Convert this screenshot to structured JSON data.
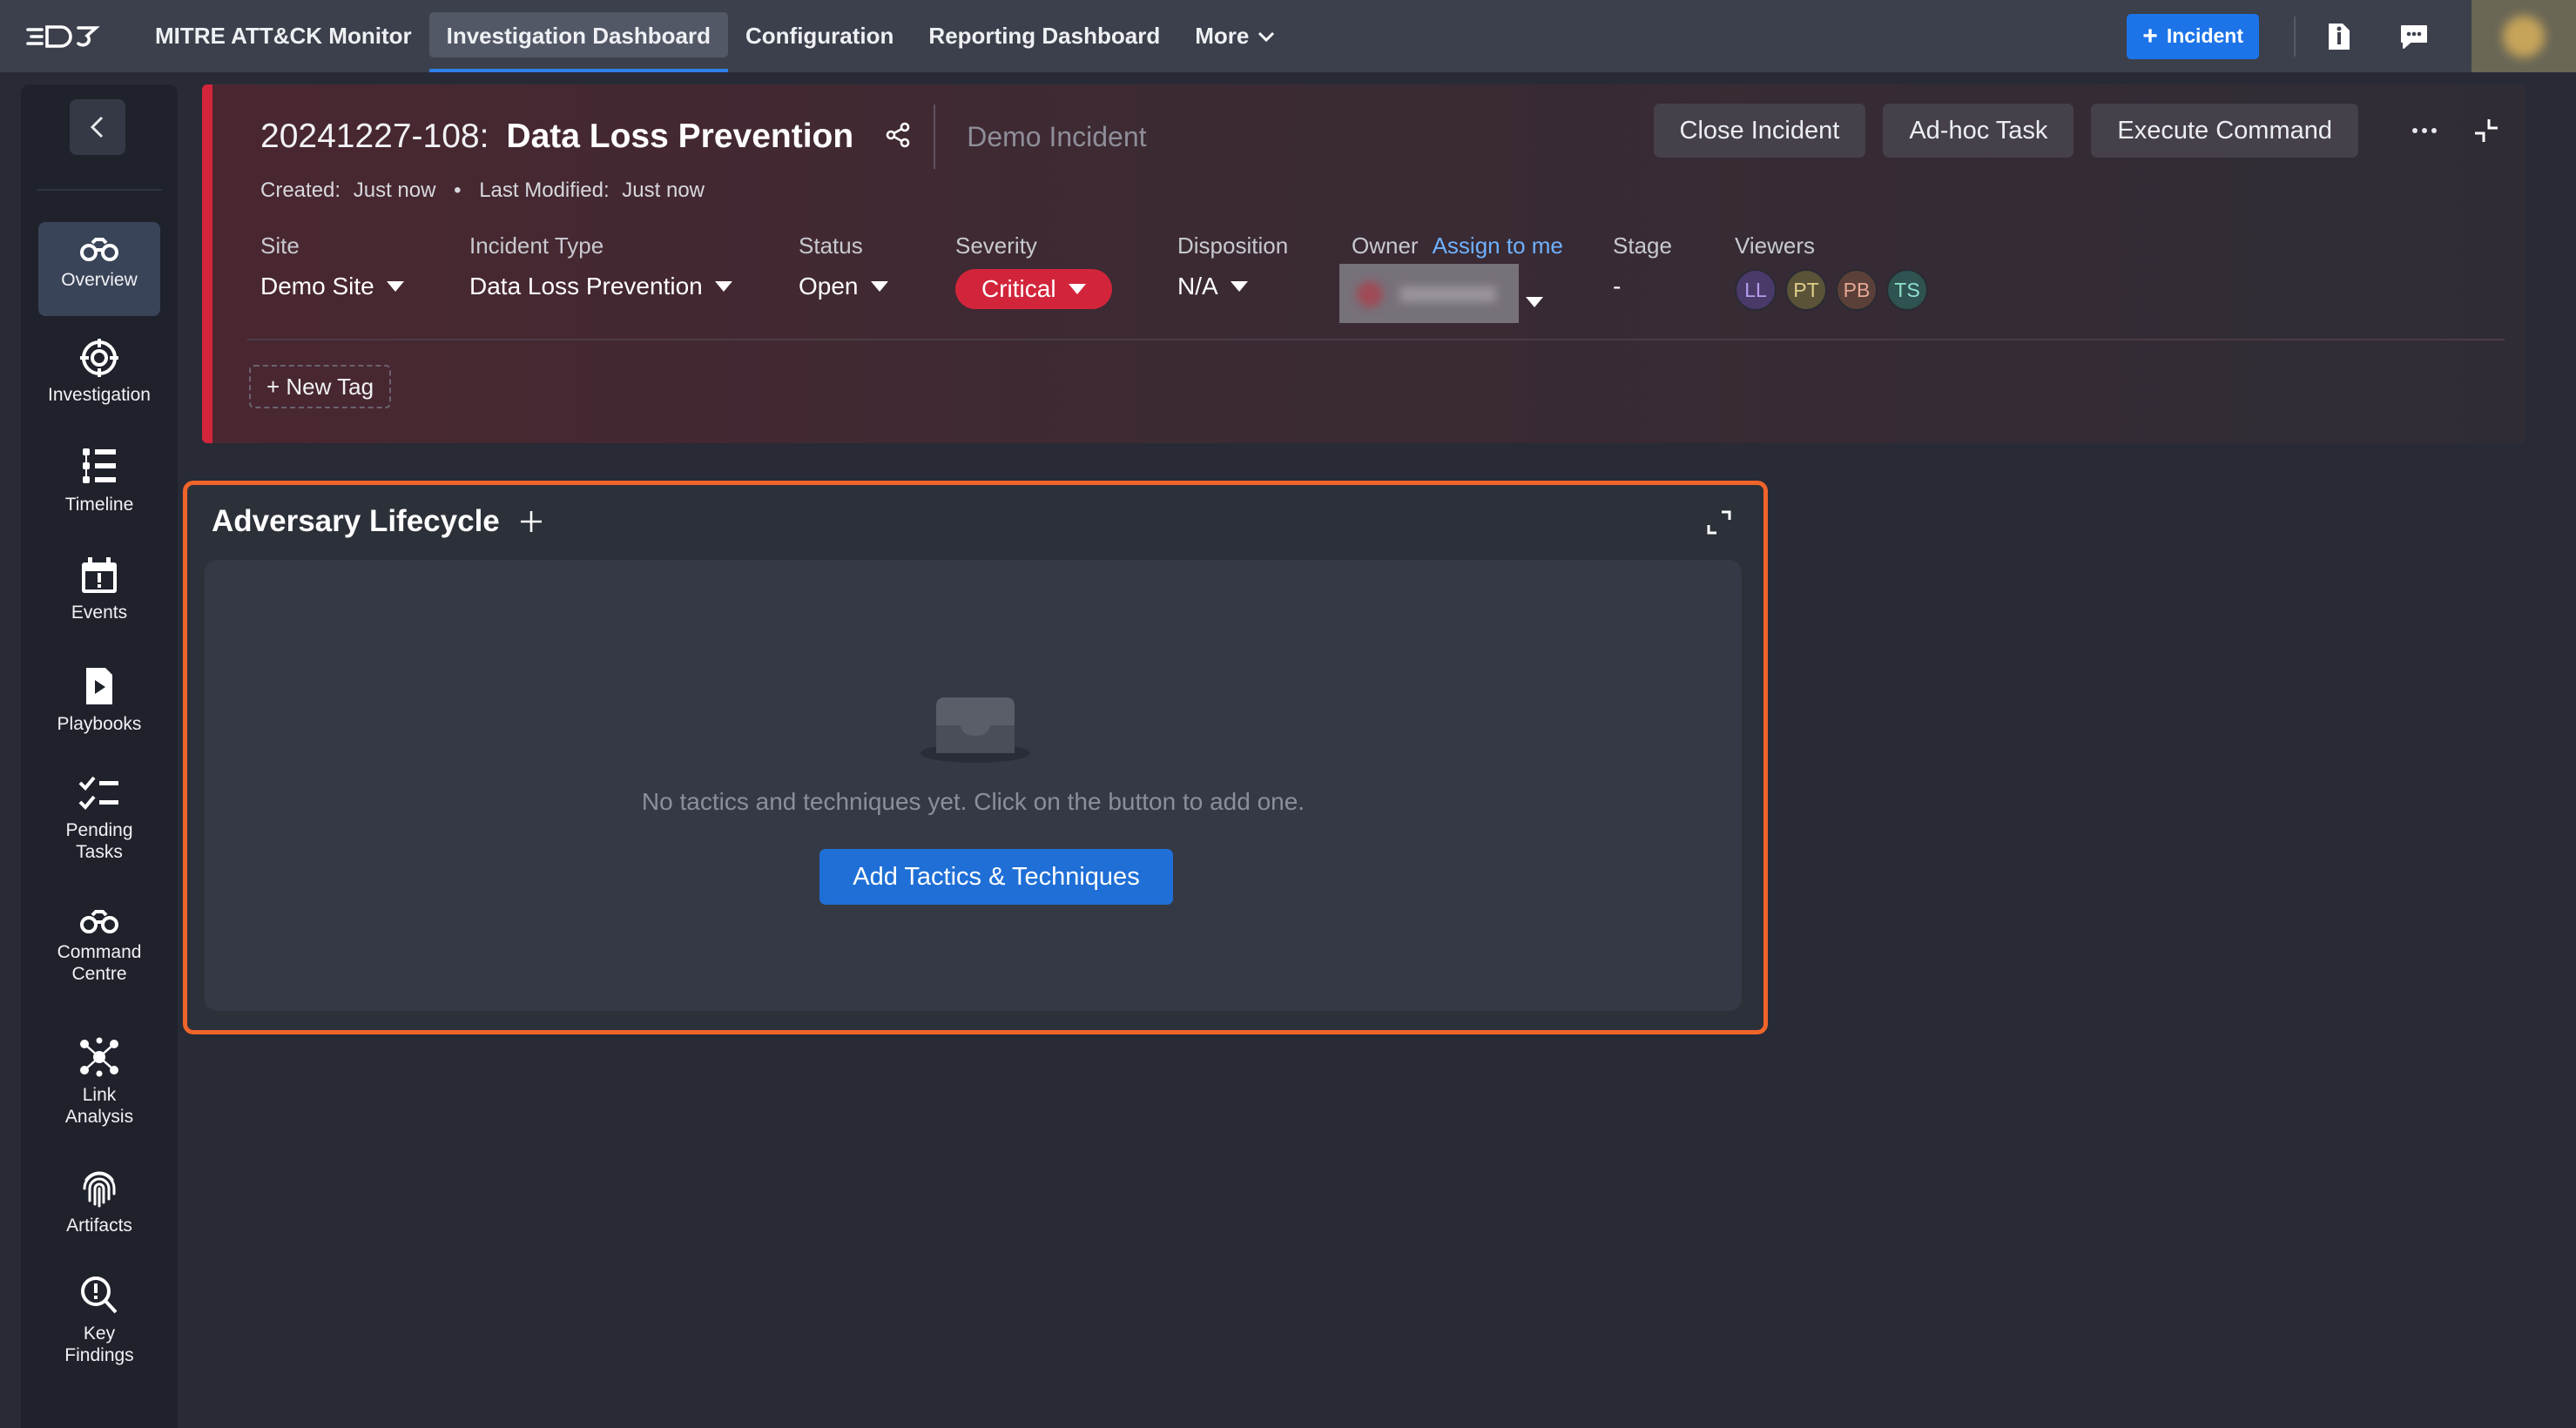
{
  "topnav": {
    "logo_text": "D3",
    "tabs": [
      {
        "label": "MITRE ATT&CK Monitor"
      },
      {
        "label": "Investigation Dashboard"
      },
      {
        "label": "Configuration"
      },
      {
        "label": "Reporting Dashboard"
      },
      {
        "label": "More"
      }
    ],
    "active_tab": "Investigation Dashboard",
    "incident_button": "Incident",
    "icons": [
      "info-document-icon",
      "chat-icon",
      "user-avatar"
    ],
    "accent_color": "#1c74e8"
  },
  "sidebar": {
    "items": [
      {
        "label": "Overview",
        "icon": "binoculars-icon",
        "active": true
      },
      {
        "label": "Investigation",
        "icon": "target-icon"
      },
      {
        "label": "Timeline",
        "icon": "timeline-list-icon"
      },
      {
        "label": "Events",
        "icon": "calendar-alert-icon"
      },
      {
        "label": "Playbooks",
        "icon": "playbook-icon"
      },
      {
        "label": "Pending Tasks",
        "icon": "checklist-icon"
      },
      {
        "label": "Command Centre",
        "icon": "binoculars-icon"
      },
      {
        "label": "Link Analysis",
        "icon": "network-icon"
      },
      {
        "label": "Artifacts",
        "icon": "fingerprint-icon"
      },
      {
        "label": "Key Findings",
        "icon": "magnifier-alert-icon"
      }
    ]
  },
  "incident": {
    "id": "20241227-108:",
    "name": "Data Loss Prevention",
    "type": "Demo Incident",
    "accent_color": "#d2253b",
    "actions": {
      "close": "Close Incident",
      "adhoc": "Ad-hoc Task",
      "execute": "Execute Command"
    },
    "created_label": "Created:",
    "created_value": "Just now",
    "modified_label": "Last Modified:",
    "modified_value": "Just now",
    "fields": {
      "site": {
        "label": "Site",
        "value": "Demo Site"
      },
      "incident_type": {
        "label": "Incident Type",
        "value": "Data Loss Prevention"
      },
      "status": {
        "label": "Status",
        "value": "Open"
      },
      "severity": {
        "label": "Severity",
        "value": "Critical"
      },
      "disposition": {
        "label": "Disposition",
        "value": "N/A"
      },
      "owner": {
        "label": "Owner",
        "assign_link": "Assign to me"
      },
      "stage": {
        "label": "Stage",
        "value": "-"
      },
      "viewers": {
        "label": "Viewers",
        "initials": [
          "LL",
          "PT",
          "PB",
          "TS"
        ]
      }
    },
    "new_tag": "+ New Tag"
  },
  "widget": {
    "title": "Adversary Lifecycle",
    "empty_text": "No tactics and techniques yet. Click on the button to add one.",
    "button": "Add Tactics & Techniques",
    "highlight_color": "#f0642a"
  }
}
